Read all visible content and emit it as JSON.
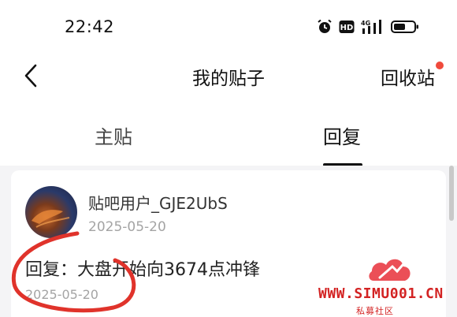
{
  "status_bar": {
    "time": "22:42",
    "hd_label": "HD",
    "network_label": "4G",
    "icons": [
      "alarm-icon",
      "hd-icon",
      "signal-icon",
      "battery-icon"
    ]
  },
  "navbar": {
    "title": "我的贴子",
    "recycle_label": "回收站",
    "back_icon": "chevron-left-icon"
  },
  "tabs": [
    {
      "label": "主贴",
      "active": false
    },
    {
      "label": "回复",
      "active": true
    }
  ],
  "reply_card": {
    "username": "贴吧用户_GJE2UbS",
    "post_date": "2025-05-20",
    "reply_text": "回复：大盘开始向3674点冲锋",
    "reply_date": "2025-05-20"
  },
  "watermark": {
    "url": "WWW.SIMU001.CN",
    "subtitle": "私募社区"
  },
  "colors": {
    "accent_red": "#f04a3c",
    "annotation_red": "#e0332b",
    "watermark_red": "#d32323",
    "muted_text": "#a4a4a4",
    "feed_background": "#f4f4f6"
  }
}
